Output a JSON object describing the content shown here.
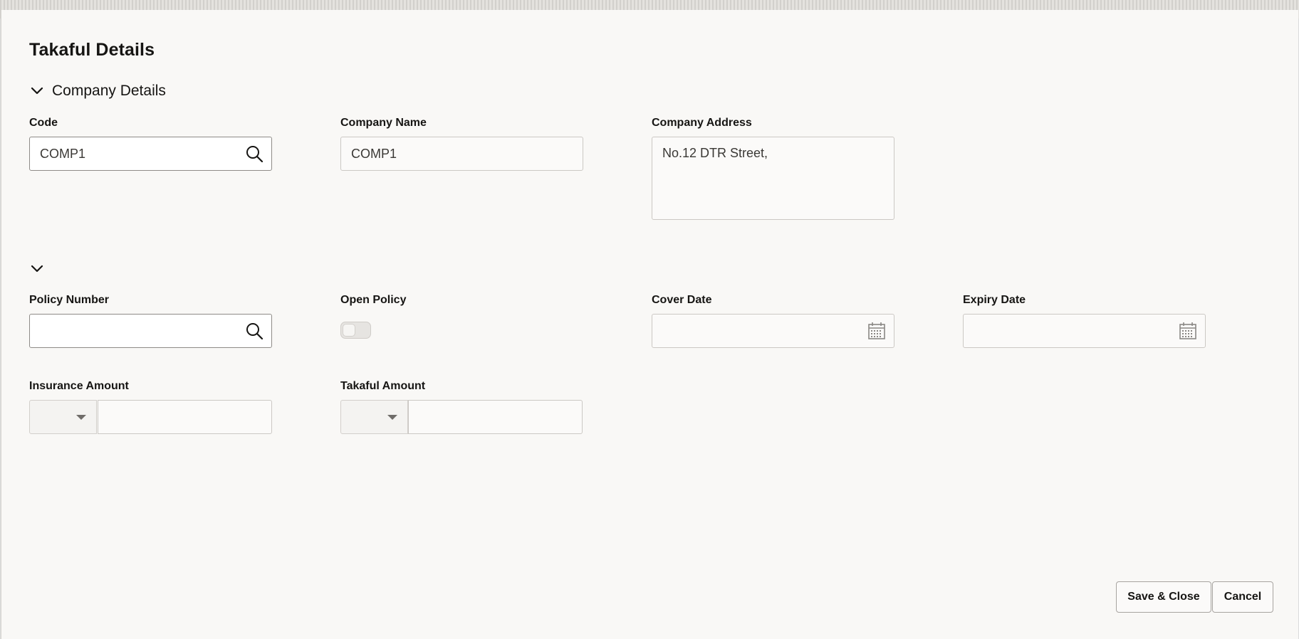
{
  "dialog": {
    "title": "Takaful Details"
  },
  "company_section": {
    "title": "Company Details",
    "code_label": "Code",
    "code_value": "COMP1",
    "name_label": "Company Name",
    "name_value": "COMP1",
    "address_label": "Company Address",
    "address_value": "No.12 DTR Street,"
  },
  "policy_section": {
    "title": "",
    "policy_number_label": "Policy Number",
    "policy_number_value": "",
    "open_policy_label": "Open Policy",
    "open_policy_on": false,
    "cover_date_label": "Cover Date",
    "cover_date_value": "",
    "expiry_date_label": "Expiry Date",
    "expiry_date_value": "",
    "insurance_amount_label": "Insurance Amount",
    "insurance_currency": "",
    "insurance_amount_value": "",
    "takaful_amount_label": "Takaful Amount",
    "takaful_currency": "",
    "takaful_amount_value": ""
  },
  "footer": {
    "save_close_label": "Save & Close",
    "cancel_label": "Cancel"
  },
  "icons": {
    "search": "search-icon",
    "calendar": "calendar-icon",
    "chevron": "chevron-down-icon",
    "caret": "caret-down-icon"
  }
}
